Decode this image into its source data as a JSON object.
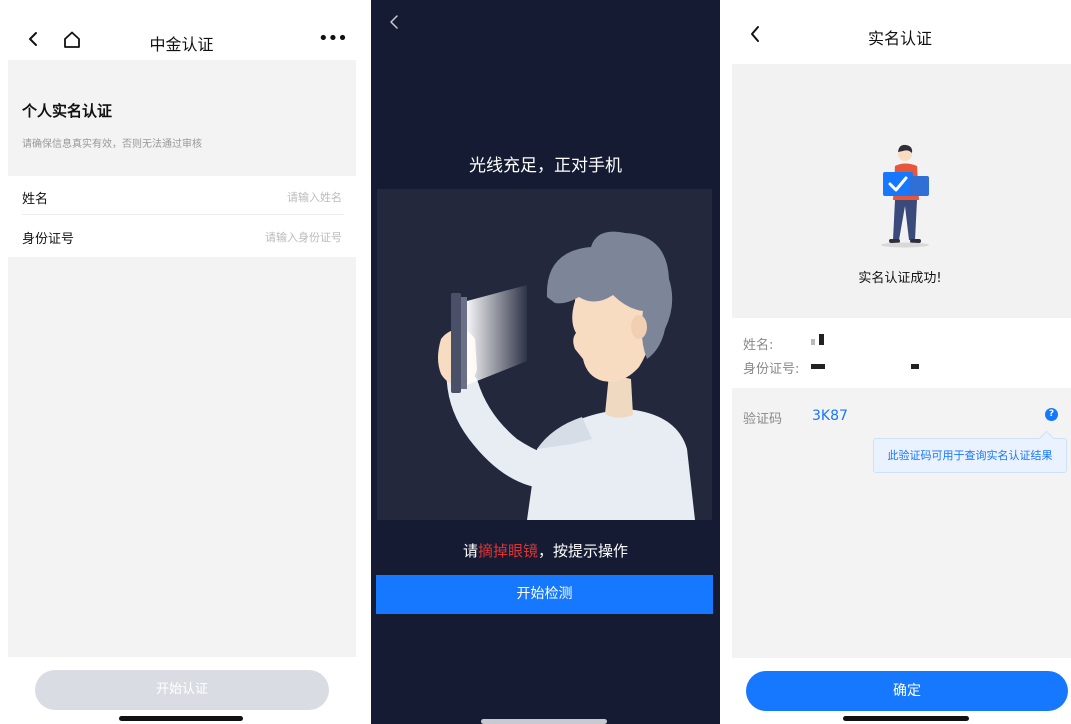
{
  "panel1": {
    "nav_title": "中金认证",
    "heading": "个人实名认证",
    "note": "请确保信息真实有效，否则无法通过审核",
    "fields": [
      {
        "label": "姓名",
        "placeholder": "请输入姓名"
      },
      {
        "label": "身份证号",
        "placeholder": "请输入身份证号"
      }
    ],
    "button_label": "开始认证",
    "icons": [
      "back-icon",
      "home-icon",
      "more-icon"
    ]
  },
  "panel2": {
    "title": "光线充足，正对手机",
    "hint_prefix": "请",
    "hint_highlight": "摘掉眼镜",
    "hint_suffix": "，按提示操作",
    "button_label": "开始检测",
    "highlight_color": "#e03232"
  },
  "panel3": {
    "nav_title": "实名认证",
    "success_text": "实名认证成功!",
    "name_label": "姓名:",
    "id_label": "身份证号:",
    "code_label": "验证码",
    "code_value": "3K87",
    "help_icon_glyph": "?",
    "tooltip": "此验证码可用于查询实名认证结果",
    "button_label": "确定"
  },
  "colors": {
    "accent": "#1677ff",
    "dark_bg": "#151b33",
    "disabled_button": "#d9dde3"
  }
}
